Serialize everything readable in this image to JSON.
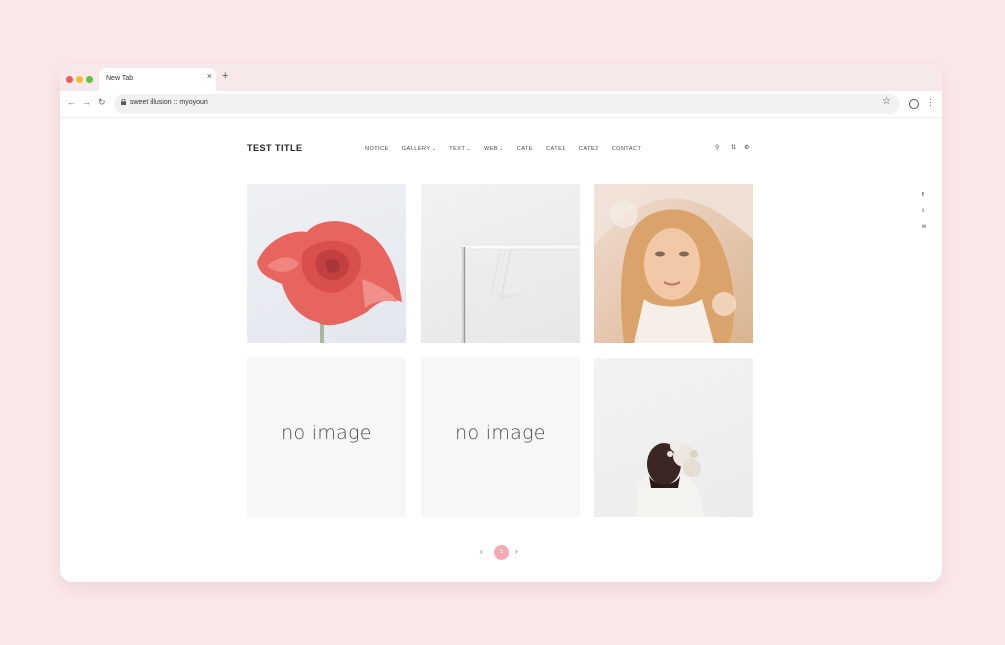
{
  "browser": {
    "tab_title": "New Tab",
    "tab_close": "×",
    "new_tab": "+",
    "url": "sweet illusion :: myoyoun",
    "back": "←",
    "forward": "→",
    "reload": "↻",
    "bookmark": "☆",
    "menu": "⋮"
  },
  "site": {
    "title": "TEST TITLE",
    "nav": [
      {
        "label": "NOTICE",
        "dropdown": false
      },
      {
        "label": "GALLERY",
        "dropdown": true
      },
      {
        "label": "TEXT",
        "dropdown": true
      },
      {
        "label": "WEB",
        "dropdown": true
      },
      {
        "label": "CATE",
        "dropdown": false
      },
      {
        "label": "CATE1",
        "dropdown": false
      },
      {
        "label": "CATE2",
        "dropdown": false
      },
      {
        "label": "CONTACT",
        "dropdown": false
      }
    ],
    "chevron": "⌄",
    "util_icons": {
      "search": "⚲",
      "sort": "⇅",
      "settings": "⚙"
    },
    "social": {
      "facebook": "f",
      "twitter": "𝕥",
      "mail": "✉"
    }
  },
  "gallery": {
    "items": [
      {
        "type": "photo",
        "subject": "rose"
      },
      {
        "type": "photo",
        "subject": "clothes-rack"
      },
      {
        "type": "photo",
        "subject": "portrait-woman"
      },
      {
        "type": "placeholder",
        "label": "no image"
      },
      {
        "type": "placeholder",
        "label": "no image"
      },
      {
        "type": "photo",
        "subject": "woman-flowers"
      }
    ]
  },
  "pagination": {
    "prev": "‹",
    "current": "1",
    "next": "›"
  },
  "colors": {
    "background": "#fbe9ea",
    "accent": "#f2a9b2"
  }
}
